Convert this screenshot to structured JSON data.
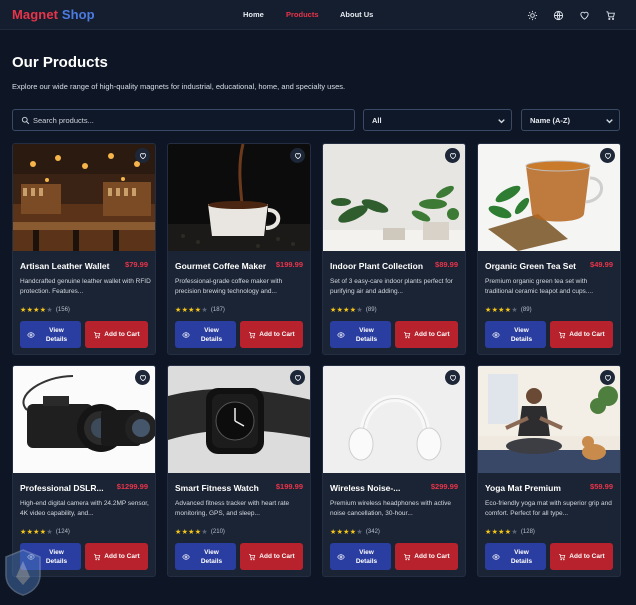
{
  "brand": {
    "part1": "Magnet",
    "part2": "Shop"
  },
  "nav": {
    "items": [
      "Home",
      "Products",
      "About Us"
    ],
    "active": "Products"
  },
  "header_icons": [
    "theme-toggle-icon",
    "globe-icon",
    "heart-icon",
    "cart-icon"
  ],
  "page": {
    "title": "Our Products",
    "subtitle": "Explore our wide range of high-quality magnets for industrial, educational, home, and specialty uses."
  },
  "filters": {
    "search_placeholder": "Search products...",
    "category_value": "All",
    "sort_value": "Name (A-Z)"
  },
  "colors": {
    "accent_red": "#e8344a",
    "brand_blue": "#4c7be0",
    "view_button": "#2a3da0",
    "cart_button": "#b8222d",
    "star": "#f5c518"
  },
  "buttons": {
    "view": "View Details",
    "cart": "Add to Cart"
  },
  "products": [
    {
      "name": "Artisan Leather Wallet",
      "price": "$79.99",
      "desc": "Handcrafted genuine leather wallet with RFID protection. Features...",
      "stars": 4,
      "count": "(156)"
    },
    {
      "name": "Gourmet Coffee Maker",
      "price": "$199.99",
      "desc": "Professional-grade coffee maker with precision brewing technology and...",
      "stars": 4,
      "count": "(187)"
    },
    {
      "name": "Indoor Plant Collection",
      "price": "$89.99",
      "desc": "Set of 3 easy-care indoor plants perfect for purifying air and adding...",
      "stars": 4,
      "count": "(89)"
    },
    {
      "name": "Organic Green Tea Set",
      "price": "$49.99",
      "desc": "Premium organic green tea set with traditional ceramic teapot and cups....",
      "stars": 4,
      "count": "(89)"
    },
    {
      "name": "Professional DSLR...",
      "price": "$1299.99",
      "desc": "High-end digital camera with 24.2MP sensor, 4K video capability, and...",
      "stars": 4,
      "count": "(124)"
    },
    {
      "name": "Smart Fitness Watch",
      "price": "$199.99",
      "desc": "Advanced fitness tracker with heart rate monitoring, GPS, and sleep...",
      "stars": 4,
      "count": "(210)"
    },
    {
      "name": "Wireless Noise-...",
      "price": "$299.99",
      "desc": "Premium wireless headphones with active noise cancellation, 30-hour...",
      "stars": 4,
      "count": "(342)"
    },
    {
      "name": "Yoga Mat Premium",
      "price": "$59.99",
      "desc": "Eco-friendly yoga mat with superior grip and comfort. Perfect for all type...",
      "stars": 4,
      "count": "(128)"
    }
  ]
}
